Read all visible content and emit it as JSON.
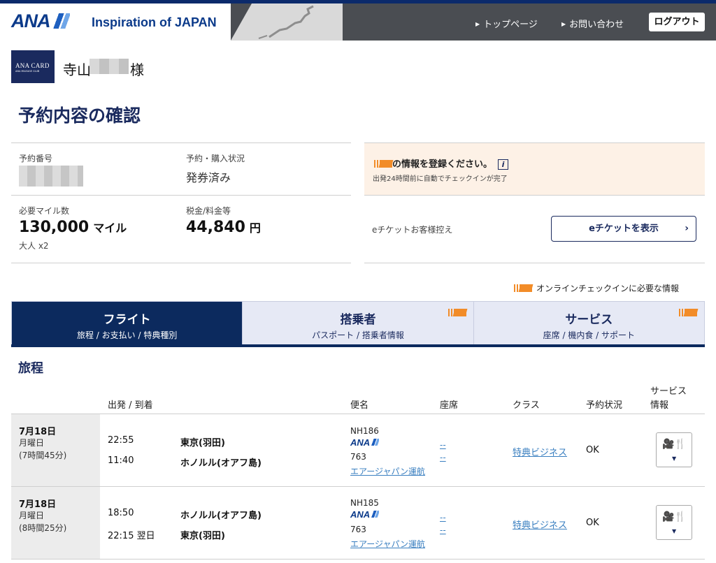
{
  "header": {
    "logo": "ANA",
    "tagline": "Inspiration of JAPAN",
    "nav": [
      {
        "label": "トップページ"
      },
      {
        "label": "お問い合わせ"
      }
    ],
    "logout_label": "ログアウト"
  },
  "user": {
    "card_title": "ANA CARD",
    "card_sub": "ANA MILEAGE CLUB",
    "name_prefix": "寺山",
    "name_suffix": "様"
  },
  "page_title": "予約内容の確認",
  "summary": {
    "reservation_number_label": "予約番号",
    "status_label": "予約・購入状況",
    "status_value": "発券済み",
    "miles_label": "必要マイル数",
    "miles_value": "130,000",
    "miles_unit": "マイル",
    "passengers": "大人 x2",
    "tax_label": "税金/料金等",
    "tax_value": "44,840",
    "tax_unit": "円",
    "eticket_label": "eチケットお客様控え",
    "eticket_button": "eチケットを表示"
  },
  "notice": {
    "title": "の情報を登録ください。",
    "info_icon": "i",
    "subtitle": "出発24時間前に自動でチェックインが完了"
  },
  "online_checkin_note": "オンラインチェックインに必要な情報",
  "tabs": [
    {
      "title": "フライト",
      "sub": "旅程 / お支払い / 特典種別",
      "active": true
    },
    {
      "title": "搭乗者",
      "sub": "パスポート / 搭乗者情報",
      "active": false
    },
    {
      "title": "サービス",
      "sub": "座席 / 機内食 / サポート",
      "active": false
    }
  ],
  "itinerary": {
    "title": "旅程",
    "headers": {
      "depart_arrive": "出発 / 到着",
      "flight": "便名",
      "seat": "座席",
      "class": "クラス",
      "status": "予約状況",
      "service_1": "サービス",
      "service_2": "情報"
    },
    "rows": [
      {
        "date": "7月18日",
        "weekday": "月曜日",
        "duration": "(7時間45分)",
        "dep_time": "22:55",
        "dep_city": "東京(羽田)",
        "arr_time": "11:40",
        "arr_city": "ホノルル(オアフ島)",
        "flight_no": "NH186",
        "airline_logo": "ANA",
        "aircraft": "763",
        "operated_by": "エアージャパン運航",
        "seat_1": "--",
        "seat_2": "--",
        "class": "特典ビジネス",
        "status": "OK"
      },
      {
        "date": "7月18日",
        "weekday": "月曜日",
        "duration": "(8時間25分)",
        "dep_time": "18:50",
        "dep_city": "ホノルル(オアフ島)",
        "arr_time": "22:15 翌日",
        "arr_city": "東京(羽田)",
        "flight_no": "NH185",
        "airline_logo": "ANA",
        "aircraft": "763",
        "operated_by": "エアージャパン運航",
        "seat_1": "--",
        "seat_2": "--",
        "class": "特典ビジネス",
        "status": "OK"
      }
    ]
  },
  "colors": {
    "brand_navy": "#0c2a5e",
    "link_blue": "#3a7fc0",
    "notice_bg": "#fdf1e6",
    "ticket_orange": "#f28c28"
  },
  "icons": {
    "ticket": "ticket-icon",
    "info": "info-icon",
    "service": "camera-meal-icon",
    "dropdown": "chevron-down-icon"
  }
}
